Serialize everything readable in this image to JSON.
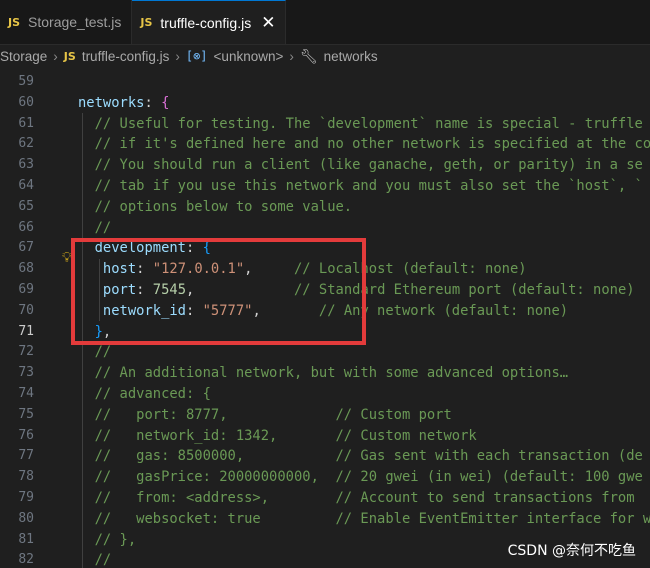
{
  "tabs": [
    {
      "icon": "JS",
      "label": "Storage_test.js",
      "active": false
    },
    {
      "icon": "JS",
      "label": "truffle-config.js",
      "active": true,
      "close": "✕"
    }
  ],
  "breadcrumb": {
    "folder": "Storage",
    "file_icon": "JS",
    "file": "truffle-config.js",
    "symbol_icon": "[⊗]",
    "symbol": "<unknown>",
    "property": "networks"
  },
  "editor": {
    "current_line": 71,
    "lines": [
      {
        "num": "59",
        "parts": []
      },
      {
        "num": "60",
        "parts": [
          {
            "t": "networks",
            "c": "k"
          },
          {
            "t": ": ",
            "c": "p"
          },
          {
            "t": "{",
            "c": "b"
          }
        ]
      },
      {
        "num": "61",
        "parts": [
          {
            "t": "  // Useful for testing. The `development` name is special - truffle",
            "c": "c"
          }
        ]
      },
      {
        "num": "62",
        "parts": [
          {
            "t": "  // if it's defined here and no other network is specified at the co",
            "c": "c"
          }
        ]
      },
      {
        "num": "63",
        "parts": [
          {
            "t": "  // You should run a client (like ganache, geth, or parity) in a se",
            "c": "c"
          }
        ]
      },
      {
        "num": "64",
        "parts": [
          {
            "t": "  // tab if you use this network and you must also set the `host`, `",
            "c": "c"
          }
        ]
      },
      {
        "num": "65",
        "parts": [
          {
            "t": "  // options below to some value.",
            "c": "c"
          }
        ]
      },
      {
        "num": "66",
        "parts": [
          {
            "t": "  //",
            "c": "c"
          }
        ]
      },
      {
        "num": "67",
        "parts": [
          {
            "t": "  development",
            "c": "k"
          },
          {
            "t": ": ",
            "c": "p"
          },
          {
            "t": "{",
            "c": "b2"
          }
        ]
      },
      {
        "num": "68",
        "parts": [
          {
            "t": "   host",
            "c": "k"
          },
          {
            "t": ": ",
            "c": "p"
          },
          {
            "t": "\"127.0.0.1\"",
            "c": "s"
          },
          {
            "t": ",     ",
            "c": "p"
          },
          {
            "t": "// Localhost (default: none)",
            "c": "c"
          }
        ]
      },
      {
        "num": "69",
        "parts": [
          {
            "t": "   port",
            "c": "k"
          },
          {
            "t": ": ",
            "c": "p"
          },
          {
            "t": "7545",
            "c": "n"
          },
          {
            "t": ",            ",
            "c": "p"
          },
          {
            "t": "// Standard Ethereum port (default: none)",
            "c": "c"
          }
        ]
      },
      {
        "num": "70",
        "parts": [
          {
            "t": "   network_id",
            "c": "k"
          },
          {
            "t": ": ",
            "c": "p"
          },
          {
            "t": "\"5777\"",
            "c": "s"
          },
          {
            "t": ",       ",
            "c": "p"
          },
          {
            "t": "// Any network (default: none)",
            "c": "c"
          }
        ]
      },
      {
        "num": "71",
        "parts": [
          {
            "t": "  }",
            "c": "b2"
          },
          {
            "t": ",",
            "c": "p"
          }
        ]
      },
      {
        "num": "72",
        "parts": [
          {
            "t": "  //",
            "c": "c"
          }
        ]
      },
      {
        "num": "73",
        "parts": [
          {
            "t": "  // An additional network, but with some advanced options…",
            "c": "c"
          }
        ]
      },
      {
        "num": "74",
        "parts": [
          {
            "t": "  // advanced: {",
            "c": "c"
          }
        ]
      },
      {
        "num": "75",
        "parts": [
          {
            "t": "  //   port: 8777,             // Custom port",
            "c": "c"
          }
        ]
      },
      {
        "num": "76",
        "parts": [
          {
            "t": "  //   network_id: 1342,       // Custom network",
            "c": "c"
          }
        ]
      },
      {
        "num": "77",
        "parts": [
          {
            "t": "  //   gas: 8500000,           // Gas sent with each transaction (de",
            "c": "c"
          }
        ]
      },
      {
        "num": "78",
        "parts": [
          {
            "t": "  //   gasPrice: 20000000000,  // 20 gwei (in wei) (default: 100 gwe",
            "c": "c"
          }
        ]
      },
      {
        "num": "79",
        "parts": [
          {
            "t": "  //   from: <address>,        // Account to send transactions from",
            "c": "c"
          }
        ]
      },
      {
        "num": "80",
        "parts": [
          {
            "t": "  //   websocket: true         // Enable EventEmitter interface for w",
            "c": "c"
          }
        ]
      },
      {
        "num": "81",
        "parts": [
          {
            "t": "  // },",
            "c": "c"
          }
        ]
      },
      {
        "num": "82",
        "parts": [
          {
            "t": "  //",
            "c": "c"
          }
        ]
      }
    ]
  },
  "watermark": "CSDN @奈何不吃鱼",
  "colors": {
    "highlight_box": "#e33b3b",
    "active_tab_accent": "#0078d4"
  }
}
